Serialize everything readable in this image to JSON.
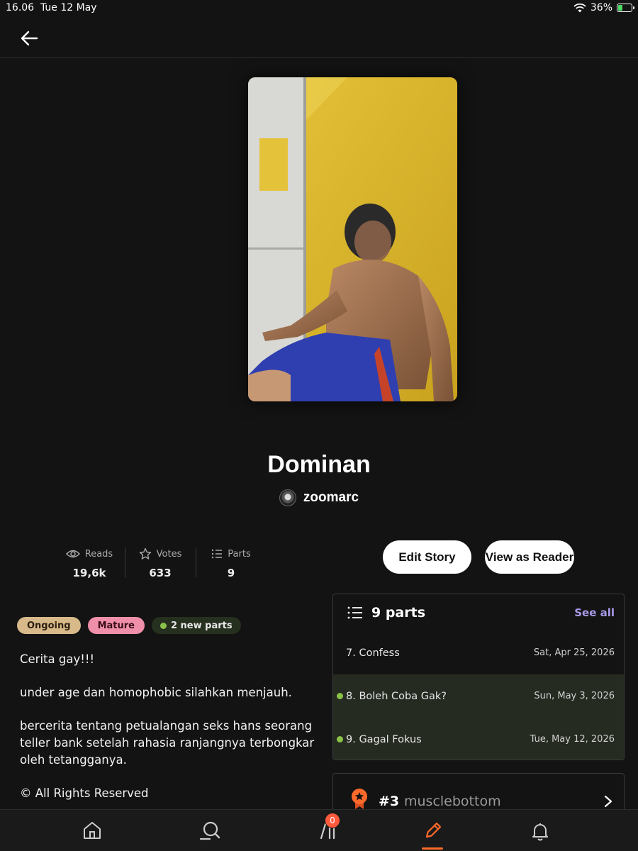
{
  "status_bar": {
    "time": "16.06",
    "date": "Tue 12 May",
    "battery_percent": "36%",
    "battery_level": 0.36
  },
  "story": {
    "title": "Dominan",
    "author": "zoomarc",
    "stats": [
      {
        "label": "Reads",
        "value": "19,6k",
        "icon": "eye-icon"
      },
      {
        "label": "Votes",
        "value": "633",
        "icon": "star-icon"
      },
      {
        "label": "Parts",
        "value": "9",
        "icon": "list-icon"
      }
    ],
    "tags": {
      "status": "Ongoing",
      "rating": "Mature",
      "new_parts": "2 new parts"
    },
    "description": [
      "Cerita gay!!!",
      "under age dan homophobic silahkan menjauh.",
      "bercerita tentang petualangan seks hans seorang teller bank setelah rahasia ranjangnya terbongkar oleh tetangganya.",
      "© All Rights Reserved"
    ]
  },
  "actions": {
    "edit_label": "Edit Story",
    "reader_label": "View as Reader"
  },
  "parts_panel": {
    "heading": "9 parts",
    "see_all": "See all",
    "parts": [
      {
        "title": "7. Confess",
        "date": "Sat, Apr 25, 2026",
        "new": false
      },
      {
        "title": "8. Boleh Coba Gak?",
        "date": "Sun, May 3, 2026",
        "new": true
      },
      {
        "title": "9. Gagal Fokus",
        "date": "Tue, May 12, 2026",
        "new": true
      }
    ]
  },
  "ranking": {
    "rank": "#3",
    "tag": "musclebottom"
  },
  "tabbar": {
    "tabs": [
      "home-icon",
      "search-icon",
      "library-icon",
      "write-icon",
      "notifications-icon"
    ],
    "active": "write-icon",
    "library_badge": "0"
  },
  "colors": {
    "accent": "#ff6a2b",
    "link": "#a99ae8",
    "new_dot": "#8bc34a",
    "background": "#131313"
  }
}
